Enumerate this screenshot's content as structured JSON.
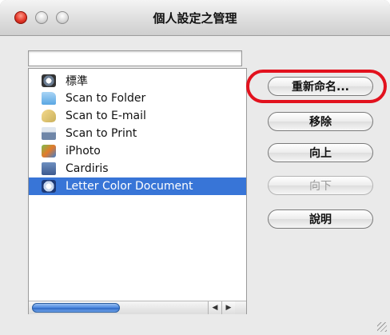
{
  "window": {
    "title": "個人設定之管理"
  },
  "list": {
    "items": [
      {
        "label": "標準",
        "icon": "scanner-standard-icon",
        "selected": false
      },
      {
        "label": "Scan to Folder",
        "icon": "folder-icon",
        "selected": false
      },
      {
        "label": "Scan to E-mail",
        "icon": "mail-icon",
        "selected": false
      },
      {
        "label": "Scan to Print",
        "icon": "printer-icon",
        "selected": false
      },
      {
        "label": "iPhoto",
        "icon": "iphoto-icon",
        "selected": false
      },
      {
        "label": "Cardiris",
        "icon": "cardiris-icon",
        "selected": false
      },
      {
        "label": "Letter Color Document",
        "icon": "scanner-profile-icon",
        "selected": true
      }
    ]
  },
  "buttons": {
    "rename": "重新命名...",
    "remove": "移除",
    "up": "向上",
    "down": "向下",
    "help": "說明"
  },
  "scrollbar": {
    "left_arrow": "◀",
    "right_arrow": "▶"
  },
  "colors": {
    "selection": "#3875d7",
    "highlight_ring": "#e2121e"
  }
}
